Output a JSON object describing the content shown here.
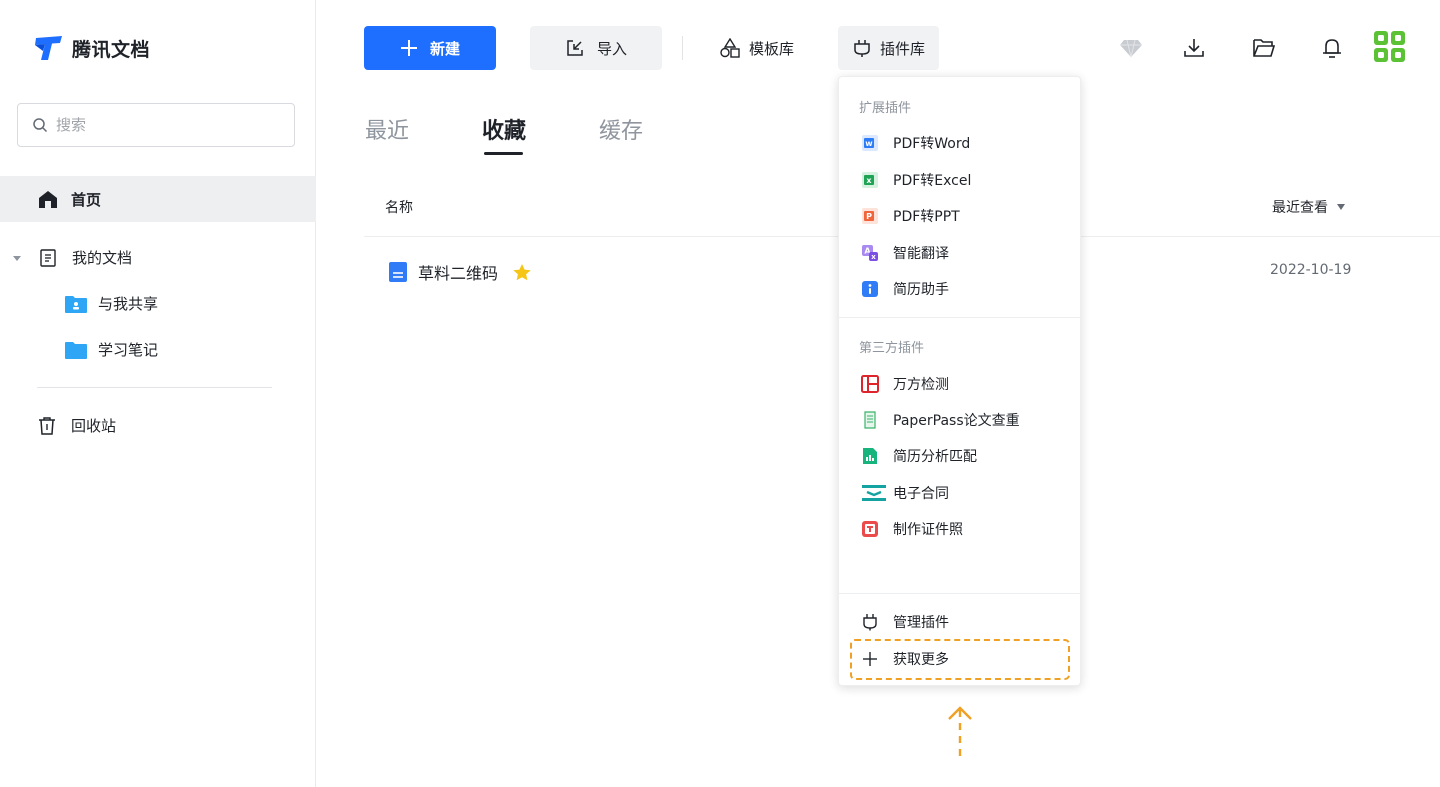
{
  "app": {
    "name": "腾讯文档"
  },
  "search": {
    "placeholder": "搜索"
  },
  "sidebar": {
    "home": "首页",
    "my_docs": "我的文档",
    "shared": "与我共享",
    "study_notes": "学习笔记",
    "trash": "回收站"
  },
  "toolbar": {
    "new_label": "新建",
    "import_label": "导入",
    "templates_label": "模板库",
    "plugins_label": "插件库"
  },
  "tabs": [
    "最近",
    "收藏",
    "缓存"
  ],
  "list": {
    "col_name": "名称",
    "col_sort": "最近查看",
    "rows": [
      {
        "title": "草料二维码",
        "date": "2022-10-19",
        "starred": true
      }
    ]
  },
  "plugin_menu": {
    "section_extensions": "扩展插件",
    "extensions": [
      {
        "label": "PDF转Word",
        "icon": "word-icon",
        "color": "#2b7cf6",
        "letter": "W"
      },
      {
        "label": "PDF转Excel",
        "icon": "excel-icon",
        "color": "#1fa354",
        "letter": "X"
      },
      {
        "label": "PDF转PPT",
        "icon": "ppt-icon",
        "color": "#f0653b",
        "letter": "P"
      },
      {
        "label": "智能翻译",
        "icon": "translate-icon",
        "color": "#8b63e8",
        "letter": "A"
      },
      {
        "label": "简历助手",
        "icon": "resume-assistant-icon",
        "color": "#2f7cf6",
        "letter": "i"
      }
    ],
    "section_third_party": "第三方插件",
    "third_party": [
      {
        "label": "万方检测",
        "icon": "wanfang-icon",
        "color": "#e0242b"
      },
      {
        "label": "PaperPass论文查重",
        "icon": "paperpass-icon",
        "color": "#39b36b"
      },
      {
        "label": "简历分析匹配",
        "icon": "resume-match-icon",
        "color": "#17b57d"
      },
      {
        "label": "电子合同",
        "icon": "e-contract-icon",
        "color": "#14a3a0"
      },
      {
        "label": "制作证件照",
        "icon": "id-photo-icon",
        "color": "#ec4b4b"
      }
    ],
    "manage": "管理插件",
    "get_more": "获取更多"
  },
  "colors": {
    "accent": "#1e6fff",
    "highlight": "#f0a023",
    "star": "#f5c518"
  }
}
